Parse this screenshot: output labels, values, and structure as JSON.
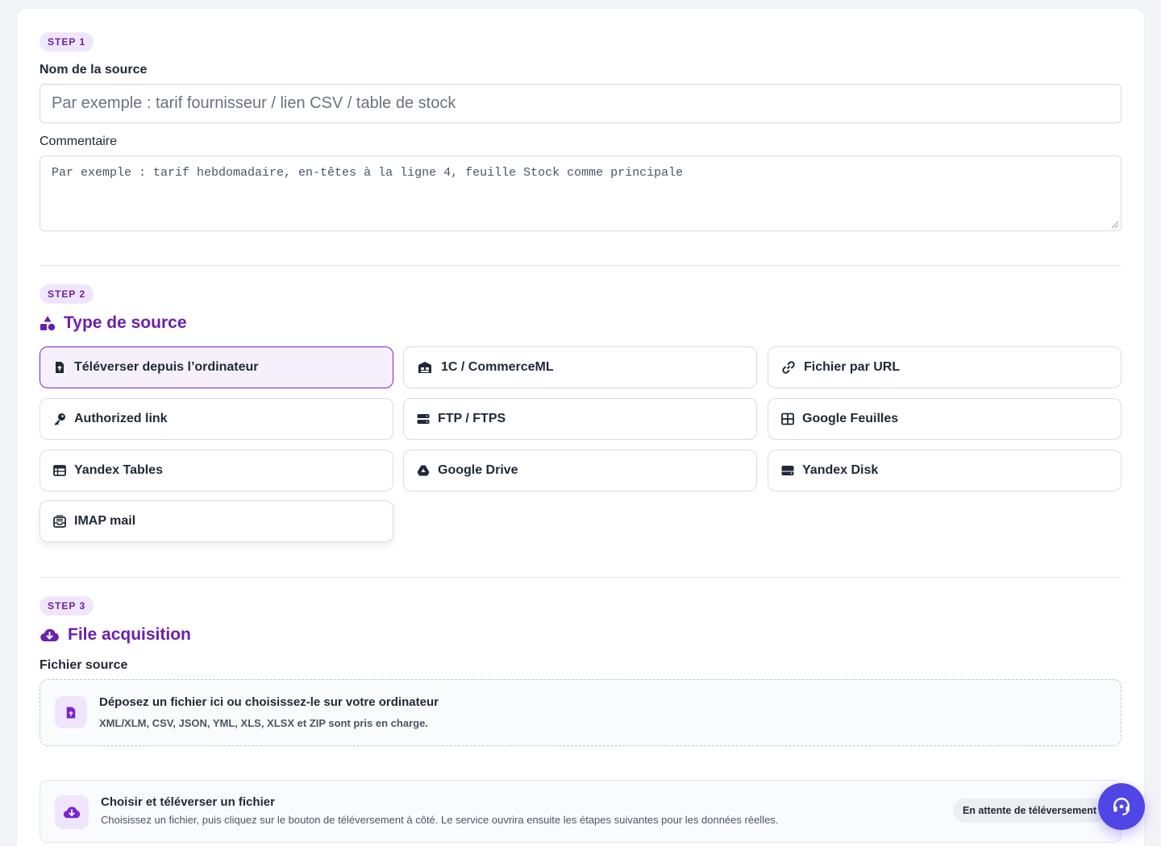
{
  "step1": {
    "badge": "STEP 1",
    "name_label": "Nom de la source",
    "name_placeholder": "Par exemple : tarif fournisseur / lien CSV / table de stock",
    "comment_label": "Commentaire",
    "comment_placeholder": "Par exemple : tarif hebdomadaire, en-têtes à la ligne 4, feuille Stock comme principale"
  },
  "step2": {
    "badge": "STEP 2",
    "title": "Type de source",
    "title_icon": "shapes-icon",
    "options": [
      {
        "label": "Téléverser depuis l’ordinateur",
        "icon": "file-upload-icon",
        "selected": true
      },
      {
        "label": "1C / CommerceML",
        "icon": "warehouse-icon",
        "selected": false
      },
      {
        "label": "Fichier par URL",
        "icon": "link-icon",
        "selected": false
      },
      {
        "label": "Authorized link",
        "icon": "key-icon",
        "selected": false
      },
      {
        "label": "FTP / FTPS",
        "icon": "server-icon",
        "selected": false
      },
      {
        "label": "Google Feuilles",
        "icon": "table-grid-icon",
        "selected": false
      },
      {
        "label": "Yandex Tables",
        "icon": "table-list-icon",
        "selected": false
      },
      {
        "label": "Google Drive",
        "icon": "google-drive-icon",
        "selected": false
      },
      {
        "label": "Yandex Disk",
        "icon": "hard-drive-icon",
        "selected": false
      },
      {
        "label": "IMAP mail",
        "icon": "inbox-mail-icon",
        "selected": false
      }
    ]
  },
  "step3": {
    "badge": "STEP 3",
    "title": "File acquisition",
    "title_icon": "cloud-download-icon",
    "source_label": "Fichier source",
    "dropzone_title": "Déposez un fichier ici ou choisissez-le sur votre ordinateur",
    "dropzone_sub": "XML/XLM, CSV, JSON, YML, XLS, XLSX et ZIP sont pris en charge.",
    "upload_title": "Choisir et téléverser un fichier",
    "upload_sub": "Choisissez un fichier, puis cliquez sur le bouton de téléversement à côté. Le service ouvrira ensuite les étapes suivantes pour les données réelles.",
    "status": "En attente de téléversement"
  },
  "colors": {
    "accent": "#6b21a8",
    "accent_light": "#efe6fb",
    "help_button": "#4f46e5"
  },
  "help_icon": "headset-icon"
}
